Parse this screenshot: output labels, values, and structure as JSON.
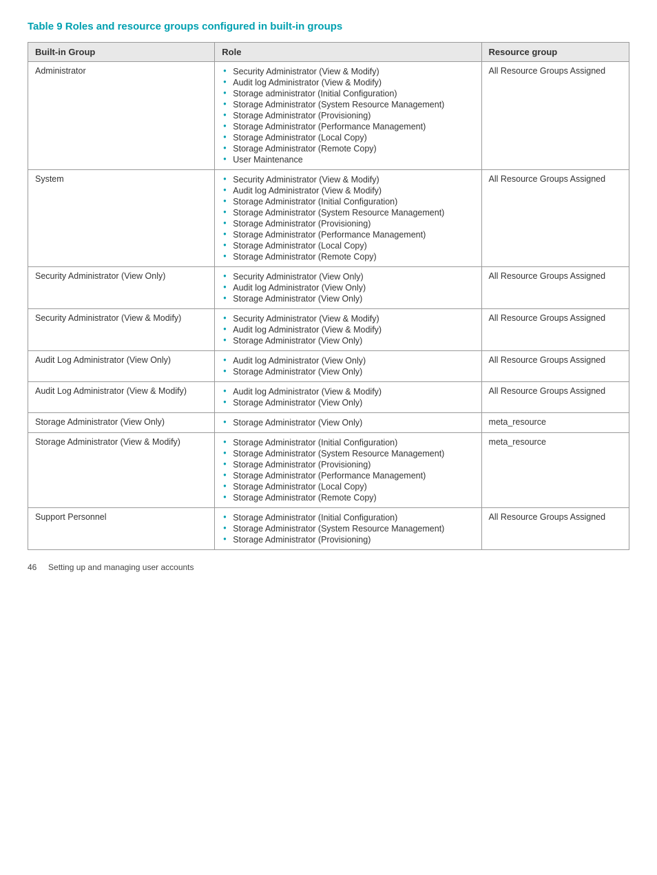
{
  "table": {
    "title": "Table 9 Roles and resource groups configured in built-in groups",
    "headers": [
      "Built-in Group",
      "Role",
      "Resource group"
    ],
    "rows": [
      {
        "group": "Administrator",
        "roles": [
          "Security Administrator (View & Modify)",
          "Audit log Administrator (View & Modify)",
          "Storage administrator (Initial Configuration)",
          "Storage Administrator (System Resource Management)",
          "Storage Administrator (Provisioning)",
          "Storage Administrator (Performance Management)",
          "Storage Administrator (Local Copy)",
          "Storage Administrator (Remote Copy)",
          "User Maintenance"
        ],
        "resource": "All Resource Groups Assigned"
      },
      {
        "group": "System",
        "roles": [
          "Security Administrator (View & Modify)",
          "Audit log Administrator (View & Modify)",
          "Storage Administrator (Initial Configuration)",
          "Storage Administrator (System Resource Management)",
          "Storage Administrator (Provisioning)",
          "Storage Administrator (Performance Management)",
          "Storage Administrator (Local Copy)",
          "Storage Administrator (Remote Copy)"
        ],
        "resource": "All Resource Groups Assigned"
      },
      {
        "group": "Security Administrator (View Only)",
        "roles": [
          "Security Administrator (View Only)",
          "Audit log Administrator (View Only)",
          "Storage Administrator (View Only)"
        ],
        "resource": "All Resource Groups Assigned"
      },
      {
        "group": "Security Administrator (View & Modify)",
        "roles": [
          "Security Administrator (View & Modify)",
          "Audit log Administrator (View & Modify)",
          "Storage Administrator (View Only)"
        ],
        "resource": "All Resource Groups Assigned"
      },
      {
        "group": "Audit Log Administrator (View Only)",
        "roles": [
          "Audit log Administrator (View Only)",
          "Storage Administrator (View Only)"
        ],
        "resource": "All Resource Groups Assigned"
      },
      {
        "group": "Audit Log Administrator (View & Modify)",
        "roles": [
          "Audit log Administrator (View & Modify)",
          "Storage Administrator (View Only)"
        ],
        "resource": "All Resource Groups Assigned"
      },
      {
        "group": "Storage Administrator (View Only)",
        "roles": [
          "Storage Administrator (View Only)"
        ],
        "resource": "meta_resource"
      },
      {
        "group": "Storage Administrator (View & Modify)",
        "roles": [
          "Storage Administrator (Initial Configuration)",
          "Storage Administrator (System Resource Management)",
          "Storage Administrator (Provisioning)",
          "Storage Administrator (Performance Management)",
          "Storage Administrator (Local Copy)",
          "Storage Administrator (Remote Copy)"
        ],
        "resource": "meta_resource"
      },
      {
        "group": "Support Personnel",
        "roles": [
          "Storage Administrator (Initial Configuration)",
          "Storage Administrator (System Resource Management)",
          "Storage Administrator (Provisioning)"
        ],
        "resource": "All Resource Groups Assigned"
      }
    ]
  },
  "footer": {
    "page": "46",
    "text": "Setting up and managing user accounts"
  }
}
